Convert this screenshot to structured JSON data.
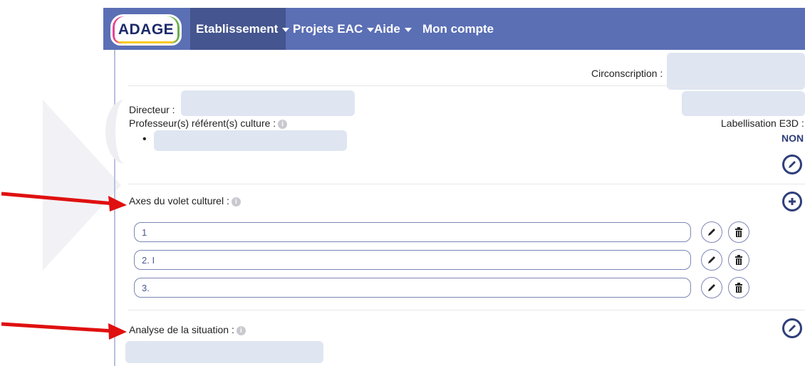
{
  "nav": {
    "logo": "ADAGE",
    "items": [
      {
        "label": "Etablissement",
        "has_caret": true,
        "active": true
      },
      {
        "label": "Projets EAC",
        "has_caret": true,
        "active": false
      },
      {
        "label": "Aide",
        "has_caret": true,
        "active": false
      },
      {
        "label": "Mon compte",
        "has_caret": false,
        "active": false
      }
    ]
  },
  "info": {
    "circonscription_label": "Circonscription :",
    "directeur_label": "Directeur :",
    "professeurs_label": "Professeur(s) référent(s) culture :",
    "labellisation_label": "Labellisation E3D :",
    "labellisation_value": "NON"
  },
  "axes": {
    "title": "Axes du volet culturel :",
    "rows": [
      {
        "value": "1"
      },
      {
        "value": "2. I"
      },
      {
        "value": "3."
      }
    ]
  },
  "analyse": {
    "title": "Analyse de la situation :"
  },
  "colors": {
    "navbar": "#5b6fb5",
    "nav_active": "#44558f",
    "accent": "#2f3f7a",
    "arrow": "#e01010"
  },
  "icons": {
    "info": "info-circle-icon",
    "edit": "pencil-icon",
    "delete": "trash-icon",
    "add": "plus-circle-icon"
  }
}
